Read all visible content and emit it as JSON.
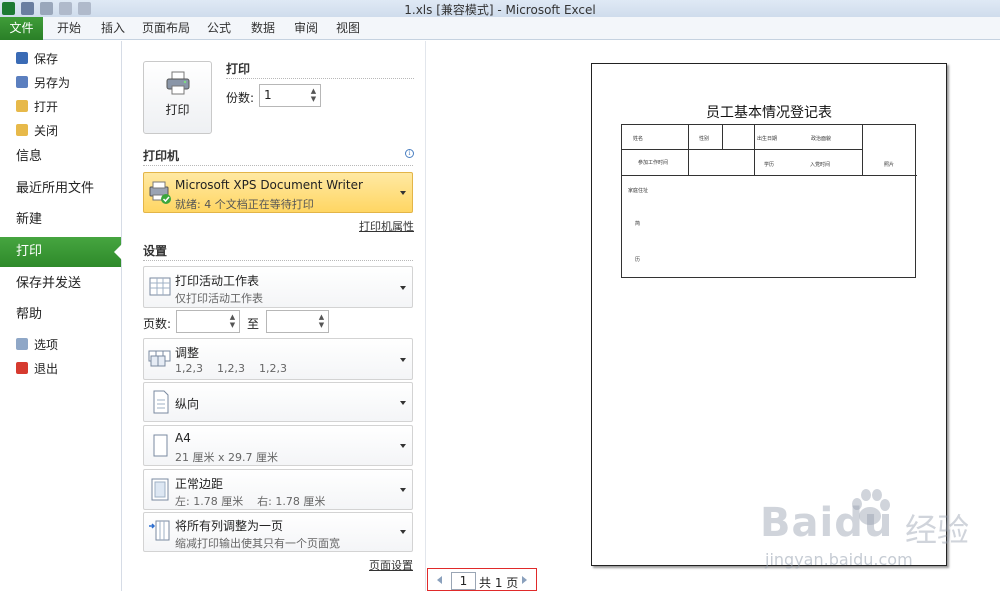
{
  "window": {
    "title": "1.xls  [兼容模式]  -  Microsoft Excel"
  },
  "ribbon": {
    "tabs": [
      "文件",
      "开始",
      "插入",
      "页面布局",
      "公式",
      "数据",
      "审阅",
      "视图"
    ]
  },
  "nav": {
    "small_items_top": [
      {
        "label": "保存",
        "icon": "save-icon"
      },
      {
        "label": "另存为",
        "icon": "save-as-icon"
      },
      {
        "label": "打开",
        "icon": "open-folder-icon"
      },
      {
        "label": "关闭",
        "icon": "close-folder-icon"
      }
    ],
    "big_items": [
      "信息",
      "最近所用文件",
      "新建",
      "打印",
      "保存并发送",
      "帮助"
    ],
    "active": "打印",
    "small_items_bottom": [
      {
        "label": "选项",
        "icon": "options-icon"
      },
      {
        "label": "退出",
        "icon": "exit-icon"
      }
    ]
  },
  "print": {
    "section_title": "打印",
    "button_label": "打印",
    "copies_label": "份数:",
    "copies_value": "1"
  },
  "printer": {
    "section_title": "打印机",
    "name": "Microsoft XPS Document Writer",
    "status": "就绪: 4 个文档正在等待打印",
    "properties_link": "打印机属性"
  },
  "settings": {
    "section_title": "设置",
    "what": {
      "main": "打印活动工作表",
      "sub": "仅打印活动工作表"
    },
    "pages_label": "页数:",
    "pages_to": "至",
    "collate": {
      "main": "调整",
      "sub": "1,2,3    1,2,3    1,2,3"
    },
    "orientation": {
      "main": "纵向"
    },
    "paper": {
      "main": "A4",
      "sub": "21 厘米 x 29.7 厘米"
    },
    "margins": {
      "main": "正常边距",
      "sub": "左: 1.78 厘米    右: 1.78 厘米"
    },
    "scaling": {
      "main": "将所有列调整为一页",
      "sub": "缩减打印输出使其只有一个页面宽"
    },
    "page_setup_link": "页面设置"
  },
  "preview": {
    "form_title": "员工基本情况登记表",
    "cells": {
      "name": "姓名",
      "gender": "性别",
      "birth": "出生日期",
      "politics": "政治面貌",
      "work_start": "参加工作时间",
      "education": "学历",
      "party_join": "入党时间",
      "photo": "照片",
      "family": "家庭住址",
      "side_1": "简",
      "side_2": "历"
    }
  },
  "pager": {
    "current": "1",
    "total_text": "共 1 页"
  },
  "watermark": {
    "brand": "Baidu",
    "cn": "经验",
    "url": "jingyan.baidu.com"
  },
  "colors": {
    "accent_green": "#2e8a2a",
    "printer_highlight": "#ffd663",
    "pager_border": "#e02a2a"
  }
}
